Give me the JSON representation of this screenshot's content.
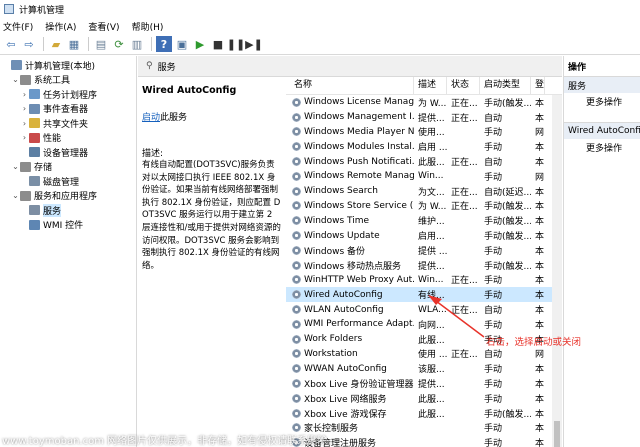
{
  "window": {
    "title": "计算机管理"
  },
  "menu": [
    "文件(F)",
    "操作(A)",
    "查看(V)",
    "帮助(H)"
  ],
  "tree": [
    {
      "label": "计算机管理(本地)",
      "exp": "",
      "indent": 0,
      "color": "#6f8fb5"
    },
    {
      "label": "系统工具",
      "exp": "⌄",
      "indent": 1,
      "color": "#8c8c8c"
    },
    {
      "label": "任务计划程序",
      "exp": "›",
      "indent": 2,
      "color": "#6a98c9"
    },
    {
      "label": "事件查看器",
      "exp": "›",
      "indent": 2,
      "color": "#6d8db3"
    },
    {
      "label": "共享文件夹",
      "exp": "›",
      "indent": 2,
      "color": "#d9b23d"
    },
    {
      "label": "性能",
      "exp": "›",
      "indent": 2,
      "color": "#c94a4a"
    },
    {
      "label": "设备管理器",
      "exp": "",
      "indent": 2,
      "color": "#5c7fa3"
    },
    {
      "label": "存储",
      "exp": "⌄",
      "indent": 1,
      "color": "#8c8c8c"
    },
    {
      "label": "磁盘管理",
      "exp": "",
      "indent": 2,
      "color": "#7a8fa6"
    },
    {
      "label": "服务和应用程序",
      "exp": "⌄",
      "indent": 1,
      "color": "#8c8c8c"
    },
    {
      "label": "服务",
      "exp": "",
      "indent": 2,
      "color": "#7d8ea3",
      "selected": true
    },
    {
      "label": "WMI 控件",
      "exp": "",
      "indent": 2,
      "color": "#5e86b3"
    }
  ],
  "middle": {
    "header": "服务",
    "service_name": "Wired AutoConfig",
    "start_link": "启动",
    "start_suffix": "此服务",
    "desc_label": "描述:",
    "desc": "有线自动配置(DOT3SVC)服务负责对以太网接口执行 IEEE 802.1X 身份验证。如果当前有线网络部署强制执行 802.1X 身份验证，则应配置 DOT3SVC 服务运行以用于建立第 2 层连接性和/或用于提供对网络资源的访问权限。DOT3SVC 服务会影响到强制执行 802.1X 身份验证的有线网络。"
  },
  "list": {
    "headers": {
      "name": "名称",
      "desc": "描述",
      "status": "状态",
      "startup": "启动类型",
      "logon": "登"
    },
    "rows": [
      {
        "name": "Windows License Manag...",
        "desc": "为 W...",
        "status": "正在...",
        "startup": "手动(触发...",
        "logon": "本"
      },
      {
        "name": "Windows Management I...",
        "desc": "提供...",
        "status": "正在...",
        "startup": "自动",
        "logon": "本"
      },
      {
        "name": "Windows Media Player N...",
        "desc": "使用...",
        "status": "",
        "startup": "手动",
        "logon": "网"
      },
      {
        "name": "Windows Modules Instal...",
        "desc": "启用 ...",
        "status": "",
        "startup": "手动",
        "logon": "本"
      },
      {
        "name": "Windows Push Notificati...",
        "desc": "此服...",
        "status": "正在...",
        "startup": "自动",
        "logon": "本"
      },
      {
        "name": "Windows Remote Manag...",
        "desc": "Win...",
        "status": "",
        "startup": "手动",
        "logon": "网"
      },
      {
        "name": "Windows Search",
        "desc": "为文...",
        "status": "正在...",
        "startup": "自动(延迟...",
        "logon": "本"
      },
      {
        "name": "Windows Store Service (...",
        "desc": "为 W...",
        "status": "正在...",
        "startup": "手动(触发...",
        "logon": "本"
      },
      {
        "name": "Windows Time",
        "desc": "维护...",
        "status": "",
        "startup": "手动(触发...",
        "logon": "本"
      },
      {
        "name": "Windows Update",
        "desc": "启用...",
        "status": "",
        "startup": "手动(触发...",
        "logon": "本"
      },
      {
        "name": "Windows 备份",
        "desc": "提供 ...",
        "status": "",
        "startup": "手动",
        "logon": "本"
      },
      {
        "name": "Windows 移动热点服务",
        "desc": "提供...",
        "status": "",
        "startup": "手动(触发...",
        "logon": "本"
      },
      {
        "name": "WinHTTP Web Proxy Aut...",
        "desc": "Win...",
        "status": "正在...",
        "startup": "手动",
        "logon": "本"
      },
      {
        "name": "Wired AutoConfig",
        "desc": "有线...",
        "status": "",
        "startup": "手动",
        "logon": "本",
        "selected": true
      },
      {
        "name": "WLAN AutoConfig",
        "desc": "WLA...",
        "status": "正在...",
        "startup": "自动",
        "logon": "本"
      },
      {
        "name": "WMI Performance Adapt...",
        "desc": "向网...",
        "status": "",
        "startup": "手动",
        "logon": "本"
      },
      {
        "name": "Work Folders",
        "desc": "此服...",
        "status": "",
        "startup": "手动",
        "logon": "本"
      },
      {
        "name": "Workstation",
        "desc": "使用 ...",
        "status": "正在...",
        "startup": "自动",
        "logon": "网"
      },
      {
        "name": "WWAN AutoConfig",
        "desc": "该服...",
        "status": "",
        "startup": "手动",
        "logon": "本"
      },
      {
        "name": "Xbox Live 身份验证管理器",
        "desc": "提供...",
        "status": "",
        "startup": "手动",
        "logon": "本"
      },
      {
        "name": "Xbox Live 网络服务",
        "desc": "此服...",
        "status": "",
        "startup": "手动",
        "logon": "本"
      },
      {
        "name": "Xbox Live 游戏保存",
        "desc": "此服...",
        "status": "",
        "startup": "手动(触发...",
        "logon": "本"
      },
      {
        "name": "家长控制服务",
        "desc": "",
        "status": "",
        "startup": "手动",
        "logon": "本"
      },
      {
        "name": "设备管理注册服务",
        "desc": "",
        "status": "",
        "startup": "手动",
        "logon": "本"
      }
    ]
  },
  "actions": {
    "title": "操作",
    "section1": "服务",
    "more1": "更多操作",
    "section2": "Wired AutoConfig",
    "more2": "更多操作"
  },
  "annotation": "右击，选择启动或关闭",
  "watermark": "www.toymoban.com 网络图片仅供展示，非存储，如有侵权请联系删除。",
  "colors": {
    "selection": "#cce8ff",
    "annotation": "#e8332b",
    "link": "#1560bd"
  }
}
